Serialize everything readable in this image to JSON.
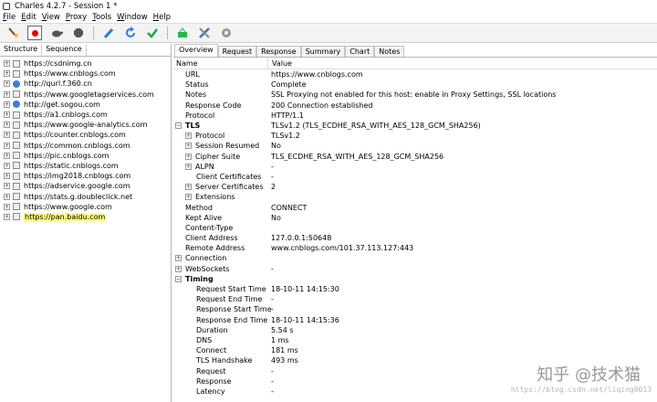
{
  "window": {
    "title": "Charles 4.2.7 - Session 1 *"
  },
  "menu": [
    {
      "pre": "",
      "u": "F",
      "post": "ile"
    },
    {
      "pre": "",
      "u": "E",
      "post": "dit"
    },
    {
      "pre": "",
      "u": "V",
      "post": "iew"
    },
    {
      "pre": "",
      "u": "P",
      "post": "roxy"
    },
    {
      "pre": "",
      "u": "T",
      "post": "ools"
    },
    {
      "pre": "",
      "u": "W",
      "post": "indow"
    },
    {
      "pre": "",
      "u": "H",
      "post": "elp"
    }
  ],
  "toolbar": [
    "broom-icon",
    "record-icon",
    "turtle-icon",
    "stop-hexagon-icon",
    "pencil-icon",
    "refresh-icon",
    "checkmark-icon",
    "basket-icon",
    "tools-icon",
    "settings-gear-icon"
  ],
  "left_tabs": [
    "Structure",
    "Sequence"
  ],
  "hosts": [
    {
      "label": "https://csdnimg.cn",
      "icon": "doc"
    },
    {
      "label": "https://www.cnblogs.com",
      "icon": "doc"
    },
    {
      "label": "http://qurl.f.360.cn",
      "icon": "globe"
    },
    {
      "label": "https://www.googletagservices.com",
      "icon": "doc"
    },
    {
      "label": "http://get.sogou.com",
      "icon": "globe"
    },
    {
      "label": "https://a1.cnblogs.com",
      "icon": "doc"
    },
    {
      "label": "https://www.google-analytics.com",
      "icon": "doc"
    },
    {
      "label": "https://counter.cnblogs.com",
      "icon": "doc"
    },
    {
      "label": "https://common.cnblogs.com",
      "icon": "doc"
    },
    {
      "label": "https://pic.cnblogs.com",
      "icon": "doc"
    },
    {
      "label": "https://static.cnblogs.com",
      "icon": "doc"
    },
    {
      "label": "https://img2018.cnblogs.com",
      "icon": "doc"
    },
    {
      "label": "https://adservice.google.com",
      "icon": "doc"
    },
    {
      "label": "https://stats.g.doubleclick.net",
      "icon": "doc"
    },
    {
      "label": "https://www.google.com",
      "icon": "doc"
    },
    {
      "label": "https://pan.baidu.com",
      "icon": "doc",
      "selected": true
    }
  ],
  "right_tabs": [
    "Overview",
    "Request",
    "Response",
    "Summary",
    "Chart",
    "Notes"
  ],
  "columns": {
    "name": "Name",
    "value": "Value"
  },
  "props": [
    {
      "n": "URL",
      "v": "https://www.cnblogs.com",
      "lvl": 1
    },
    {
      "n": "Status",
      "v": "Complete",
      "lvl": 1
    },
    {
      "n": "Notes",
      "v": "SSL Proxying not enabled for this host: enable in Proxy Settings, SSL locations",
      "lvl": 1
    },
    {
      "n": "Response Code",
      "v": "200 Connection established",
      "lvl": 1
    },
    {
      "n": "Protocol",
      "v": "HTTP/1.1",
      "lvl": 1
    },
    {
      "n": "TLS",
      "v": "TLSv1.2 (TLS_ECDHE_RSA_WITH_AES_128_GCM_SHA256)",
      "lvl": 0,
      "pm": "−",
      "bold": true
    },
    {
      "n": "Protocol",
      "v": "TLSv1.2",
      "lvl": 2,
      "pm": "+"
    },
    {
      "n": "Session Resumed",
      "v": "No",
      "lvl": 2,
      "pm": "+"
    },
    {
      "n": "Cipher Suite",
      "v": "TLS_ECDHE_RSA_WITH_AES_128_GCM_SHA256",
      "lvl": 2,
      "pm": "+"
    },
    {
      "n": "ALPN",
      "v": "-",
      "lvl": 2,
      "pm": "+"
    },
    {
      "n": "Client Certificates",
      "v": "-",
      "lvl": 3
    },
    {
      "n": "Server Certificates",
      "v": "2",
      "lvl": 2,
      "pm": "+"
    },
    {
      "n": "Extensions",
      "v": "",
      "lvl": 2,
      "pm": "+"
    },
    {
      "n": "Method",
      "v": "CONNECT",
      "lvl": 1
    },
    {
      "n": "Kept Alive",
      "v": "No",
      "lvl": 1
    },
    {
      "n": "Content-Type",
      "v": "",
      "lvl": 1
    },
    {
      "n": "Client Address",
      "v": "127.0.0.1:50648",
      "lvl": 1
    },
    {
      "n": "Remote Address",
      "v": "www.cnblogs.com/101.37.113.127:443",
      "lvl": 1
    },
    {
      "n": "Connection",
      "v": "",
      "lvl": 0,
      "pm": "+"
    },
    {
      "n": "WebSockets",
      "v": "-",
      "lvl": 0,
      "pm": "+"
    },
    {
      "n": "Timing",
      "v": "",
      "lvl": 0,
      "pm": "−",
      "bold": true
    },
    {
      "n": "Request Start Time",
      "v": "18-10-11 14:15:30",
      "lvl": 3
    },
    {
      "n": "Request End Time",
      "v": "-",
      "lvl": 3
    },
    {
      "n": "Response Start Time",
      "v": "-",
      "lvl": 3
    },
    {
      "n": "Response End Time",
      "v": "18-10-11 14:15:36",
      "lvl": 3
    },
    {
      "n": "Duration",
      "v": "5.54 s",
      "lvl": 3
    },
    {
      "n": "DNS",
      "v": "1 ms",
      "lvl": 3
    },
    {
      "n": "Connect",
      "v": "181 ms",
      "lvl": 3
    },
    {
      "n": "TLS Handshake",
      "v": "493 ms",
      "lvl": 3
    },
    {
      "n": "Request",
      "v": "-",
      "lvl": 3
    },
    {
      "n": "Response",
      "v": "-",
      "lvl": 3
    },
    {
      "n": "Latency",
      "v": "-",
      "lvl": 3
    }
  ],
  "watermark": {
    "main": "知乎 @技术猫",
    "url": "https://blog.csdn.net/liqing0013"
  }
}
